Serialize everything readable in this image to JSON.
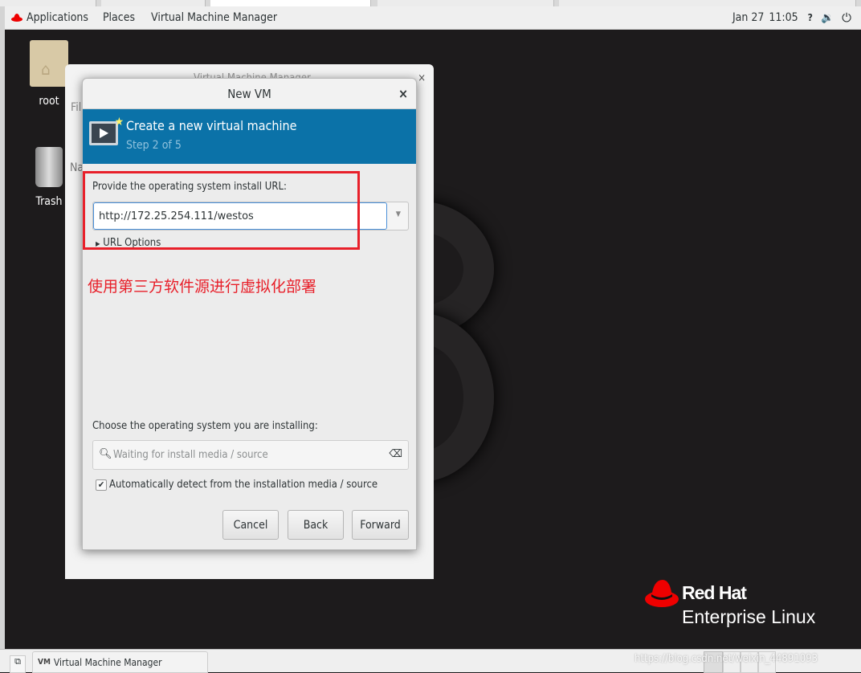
{
  "topbar": {
    "applications": "Applications",
    "places": "Places",
    "app_menu": "Virtual Machine Manager",
    "date": "Jan 27",
    "time": "11:05"
  },
  "desktop": {
    "icons": [
      {
        "label": "root",
        "icon": "home-folder-icon"
      },
      {
        "label": "Trash",
        "icon": "trash-icon"
      }
    ],
    "logo": {
      "line1": "Red Hat",
      "line2": "Enterprise Linux"
    }
  },
  "background_window": {
    "title": "Virtual Machine Manager",
    "menu_partial": "Fil",
    "column_partial": "Na"
  },
  "dialog": {
    "title": "New VM",
    "banner": {
      "title": "Create a new virtual machine",
      "step": "Step 2 of 5"
    },
    "url_label": "Provide the operating system install URL:",
    "url_value": "http://172.25.254.111/westos",
    "url_options": "URL Options",
    "os_label": "Choose the operating system you are installing:",
    "os_search_placeholder": "Waiting for install media / source",
    "auto_detect_label": "Automatically detect from the installation media / source",
    "auto_detect_checked": true,
    "buttons": {
      "cancel": "Cancel",
      "back": "Back",
      "forward": "Forward"
    }
  },
  "annotation": {
    "text": "使用第三方软件源进行虚拟化部署",
    "color": "#e8202a"
  },
  "taskbar": {
    "window_label": "Virtual Machine Manager",
    "watermark": "https://blog.csdn.net/weixin_44891093"
  },
  "colors": {
    "banner": "#0b72a8",
    "accent_red": "#ee0000"
  }
}
